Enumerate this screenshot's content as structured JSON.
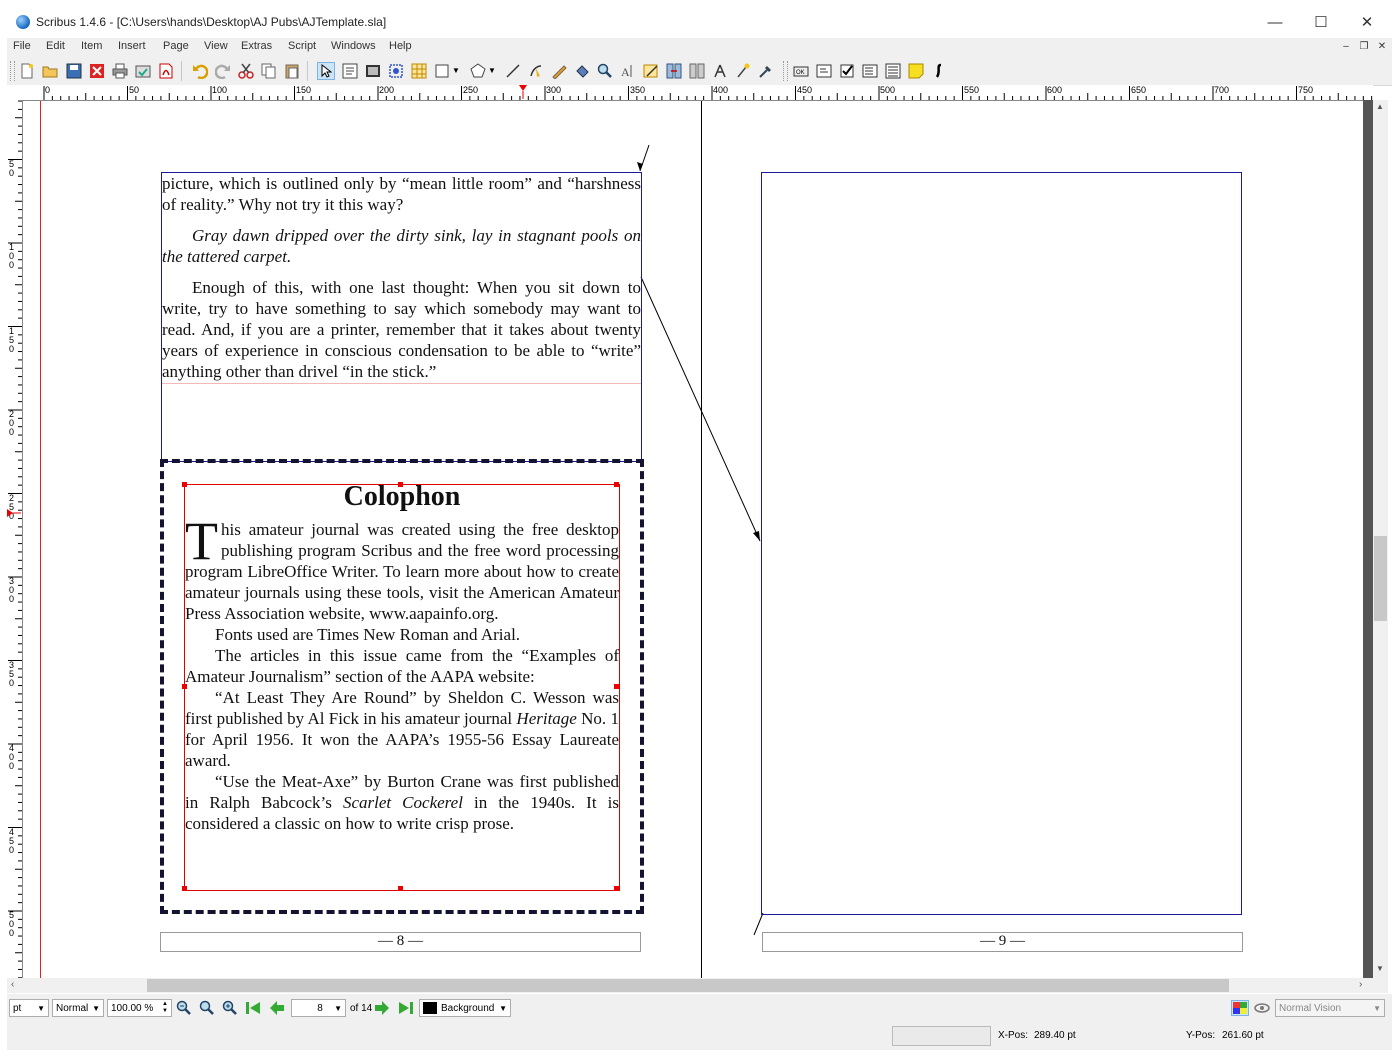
{
  "window": {
    "title": "Scribus 1.4.6 - [C:\\Users\\hands\\Desktop\\AJ Pubs\\AJTemplate.sla]"
  },
  "menu": {
    "items": [
      "File",
      "Edit",
      "Item",
      "Insert",
      "Page",
      "View",
      "Extras",
      "Script",
      "Windows",
      "Help"
    ]
  },
  "rulers": {
    "horizontal": [
      "0",
      "50",
      "100",
      "150",
      "200",
      "250",
      "300",
      "350",
      "400",
      "450",
      "500",
      "550",
      "600",
      "650",
      "700",
      "750"
    ],
    "vertical": [
      "50",
      "100",
      "150",
      "200",
      "250",
      "300",
      "350",
      "400",
      "450",
      "500"
    ]
  },
  "page_left": {
    "story": {
      "p1": "picture, which is outlined only by “mean little room” and “harshness of reality.” Why not try it this way?",
      "p2": "Gray dawn dripped over the dirty sink, lay in stagnant pools on the tattered carpet.",
      "p3": "Enough of this, with one last thought: When you sit down to write, try to have something to say which somebody may want to read. And, if you are a printer, remember that it takes about twenty years of experience in conscious condensation to be able to “write” anything other than drivel “in the stick.”"
    },
    "colophon": {
      "title": "Colophon",
      "dropcap": "T",
      "p1": "his amateur journal was created using the free desktop publishing program Scribus and the free word processing program LibreOffice Writer. To learn more about how to create amateur journals using these tools, visit the American Amateur Press Association website, www.aapainfo.org.",
      "p2": "Fonts used are Times New Roman and Arial.",
      "p3": "The articles in this issue came from the “Examples of Amateur Journalism” section of the AAPA website:",
      "p4_a": "“At Least They Are Round” by Sheldon C. Wesson was first published by Al Fick in his amateur journal ",
      "p4_italic": "Heritage",
      "p4_b": " No. 1 for April 1956. It won the AAPA’s 1955-56 Essay Laureate award.",
      "p5_a": "“Use the Meat-Axe” by Burton Crane was first published in Ralph Babcock’s ",
      "p5_italic": "Scarlet Cockerel",
      "p5_b": " in the 1940s. It is considered a classic on how to write crisp prose."
    },
    "page_number": "— 8 —"
  },
  "page_right": {
    "page_number": "— 9 —"
  },
  "statusbar": {
    "unit": "pt",
    "image_quality": "Normal",
    "zoom": "100.00 %",
    "current_page": "8",
    "page_total": "of 14",
    "layer": "Background",
    "view_mode": "Normal Vision",
    "xpos_label": "X-Pos:",
    "xpos_value": "289.40 pt",
    "ypos_label": "Y-Pos:",
    "ypos_value": "261.60 pt"
  },
  "icons": [
    "app-icon",
    "new-icon",
    "open-icon",
    "save-icon",
    "close-doc-icon",
    "print-icon",
    "preflight-icon",
    "pdf-icon",
    "undo-icon",
    "redo-icon",
    "cut-icon",
    "copy-icon",
    "paste-icon",
    "select-icon",
    "text-frame-icon",
    "image-frame-icon",
    "render-frame-icon",
    "table-icon",
    "shape-icon",
    "polygon-icon",
    "line-icon",
    "bezier-icon",
    "freehand-icon",
    "rotate-icon",
    "zoom-icon",
    "edit-text-icon",
    "story-editor-icon",
    "link-frames-icon",
    "unlink-frames-icon",
    "measure-icon",
    "copy-properties-icon",
    "eyedropper-icon",
    "pdf-button-icon",
    "pdf-textfield-icon",
    "pdf-checkbox-icon",
    "pdf-combobox-icon",
    "pdf-listbox-icon",
    "pdf-annotation-icon",
    "pdf-link-icon"
  ],
  "colors": {
    "frame_outline": "#1b1b9a",
    "selection": "#e00000",
    "chrome": "#f0f0f0"
  }
}
